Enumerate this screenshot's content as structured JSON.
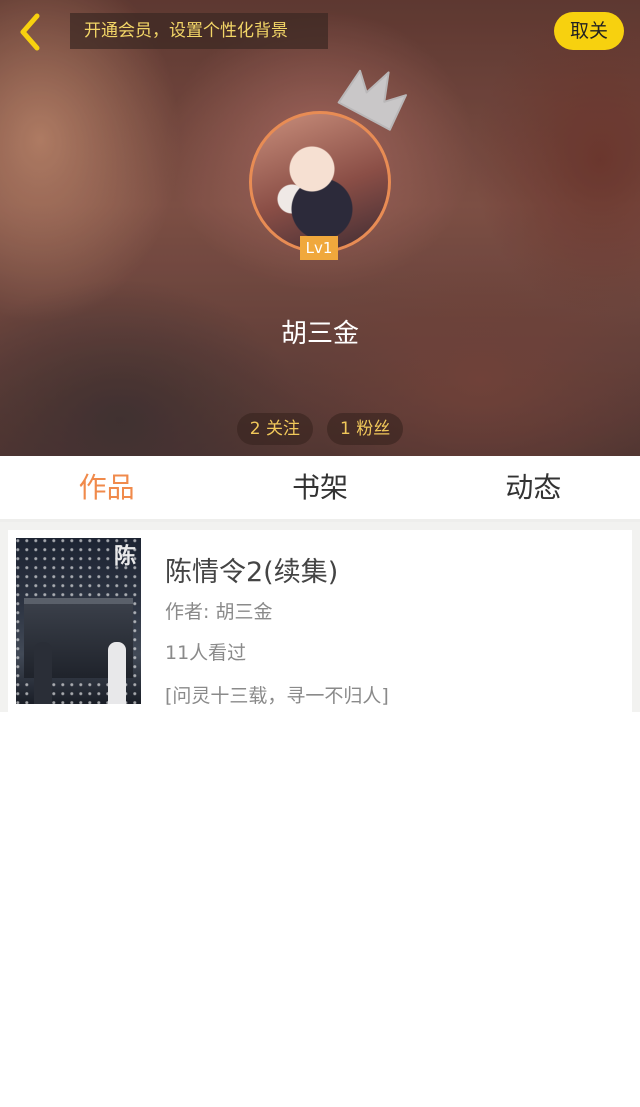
{
  "header": {
    "promo_banner": "开通会员，设置个性化背景",
    "follow_button": "取关",
    "level": "Lv1",
    "username": "胡三金",
    "stats": [
      {
        "label": "2 关注"
      },
      {
        "label": "1 粉丝"
      }
    ]
  },
  "tabs": [
    {
      "label": "作品",
      "active": true
    },
    {
      "label": "书架",
      "active": false
    },
    {
      "label": "动态",
      "active": false
    }
  ],
  "books": [
    {
      "title": "陈情令2(续集)",
      "author": "作者: 胡三金",
      "views": "11人看过",
      "description": "[问灵十三载，寻一不归人]"
    }
  ],
  "colors": {
    "accent": "#f08a4b",
    "follow_button_bg": "#f7d10f",
    "banner_text": "#f3d667",
    "level_badge": "#f0a83c"
  },
  "icons": {
    "back": "chevron-left-icon",
    "crown": "crown-icon"
  }
}
